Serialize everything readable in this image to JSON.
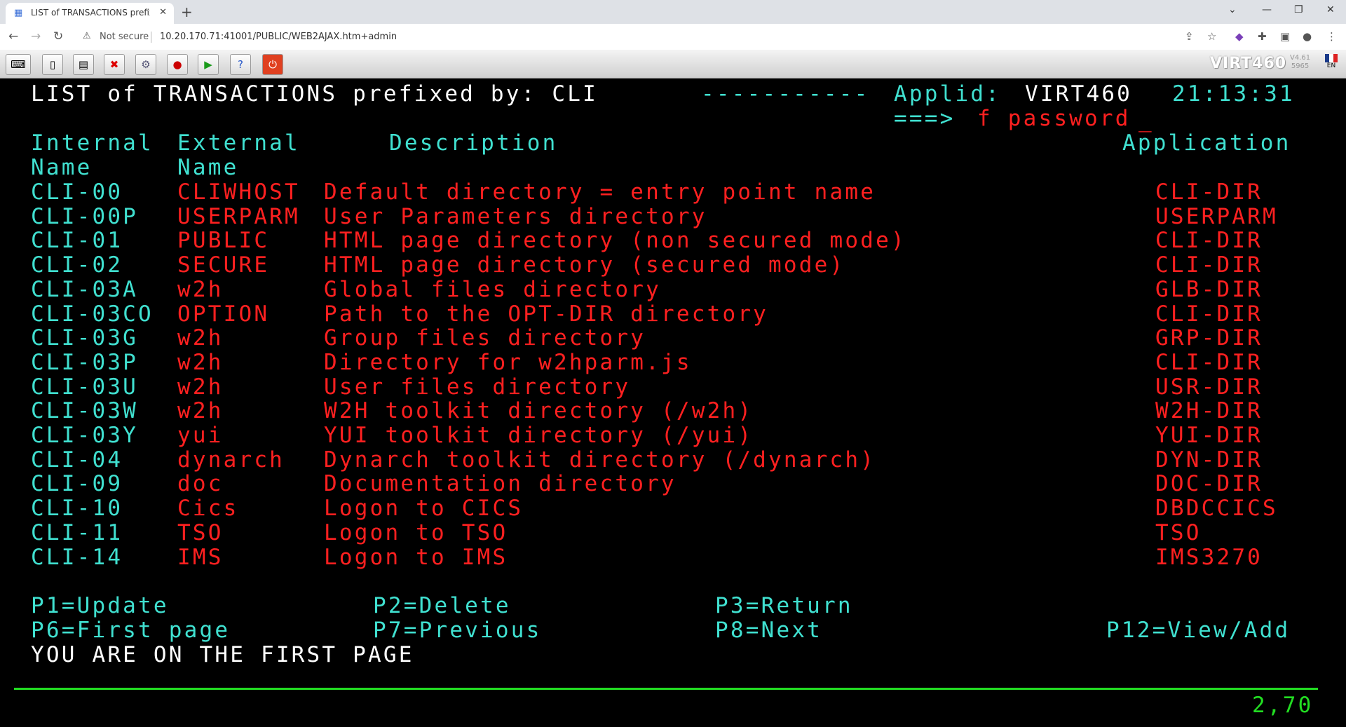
{
  "browser": {
    "tab_title": "LIST of TRANSACTIONS prefixed by: CLI",
    "not_secure": "Not secure",
    "url": "10.20.170.71:41001/PUBLIC/WEB2AJAX.htm+admin"
  },
  "app": {
    "brand": "VIRT460",
    "version": "V4.61",
    "build": "5965",
    "lang": "EN"
  },
  "screen": {
    "title": "LIST of TRANSACTIONS prefixed by: CLI",
    "dashes": "-----------",
    "applid_label": "Applid:",
    "applid_value": "VIRT460",
    "time": "21:13:31",
    "prompt_arrow": "===>",
    "command": "f password",
    "headers": {
      "internal1": "Internal",
      "internal2": "Name",
      "external1": "External",
      "external2": "Name",
      "description": "Description",
      "application": "Application"
    },
    "rows": [
      {
        "internal": "CLI-00",
        "external": "CLIWHOST",
        "description": "Default directory = entry point name",
        "application": "CLI-DIR"
      },
      {
        "internal": "CLI-00P",
        "external": "USERPARM",
        "description": "User Parameters directory",
        "application": "USERPARM"
      },
      {
        "internal": "CLI-01",
        "external": "PUBLIC",
        "description": "HTML page directory (non secured mode)",
        "application": "CLI-DIR"
      },
      {
        "internal": "CLI-02",
        "external": "SECURE",
        "description": "HTML page directory (secured mode)",
        "application": "CLI-DIR"
      },
      {
        "internal": "CLI-03A",
        "external": "w2h",
        "description": "Global files directory",
        "application": "GLB-DIR"
      },
      {
        "internal": "CLI-03CO",
        "external": "OPTION",
        "description": "Path to the OPT-DIR directory",
        "application": "CLI-DIR"
      },
      {
        "internal": "CLI-03G",
        "external": "w2h",
        "description": "Group files directory",
        "application": "GRP-DIR"
      },
      {
        "internal": "CLI-03P",
        "external": "w2h",
        "description": "Directory for w2hparm.js",
        "application": "CLI-DIR"
      },
      {
        "internal": "CLI-03U",
        "external": "w2h",
        "description": "User files directory",
        "application": "USR-DIR"
      },
      {
        "internal": "CLI-03W",
        "external": "w2h",
        "description": "W2H toolkit directory (/w2h)",
        "application": "W2H-DIR"
      },
      {
        "internal": "CLI-03Y",
        "external": "yui",
        "description": "YUI toolkit directory (/yui)",
        "application": "YUI-DIR"
      },
      {
        "internal": "CLI-04",
        "external": "dynarch",
        "description": "Dynarch toolkit directory (/dynarch)",
        "application": "DYN-DIR"
      },
      {
        "internal": "CLI-09",
        "external": "doc",
        "description": "Documentation directory",
        "application": "DOC-DIR"
      },
      {
        "internal": "CLI-10",
        "external": "Cics",
        "description": "Logon to CICS",
        "application": "DBDCCICS"
      },
      {
        "internal": "CLI-11",
        "external": "TSO",
        "description": "Logon to TSO",
        "application": "TSO"
      },
      {
        "internal": "CLI-14",
        "external": "IMS",
        "description": "Logon to IMS",
        "application": "IMS3270"
      }
    ],
    "pf_keys": {
      "p1": "P1=Update",
      "p2": "P2=Delete",
      "p3": "P3=Return",
      "p6": "P6=First page",
      "p7": "P7=Previous",
      "p8": "P8=Next",
      "p12": "P12=View/Add"
    },
    "message": "YOU ARE ON THE FIRST PAGE",
    "cursor_pos": "2,70"
  }
}
